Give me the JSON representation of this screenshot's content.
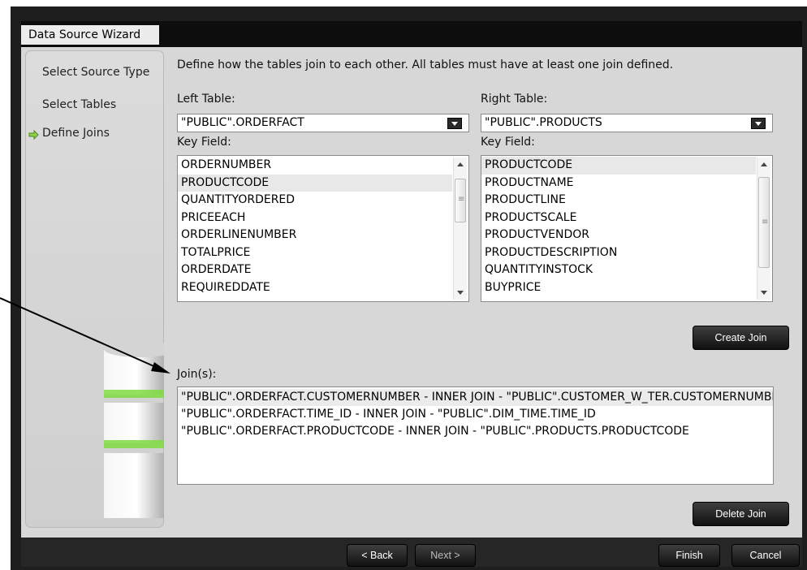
{
  "window": {
    "title": "Data Source Wizard"
  },
  "nav": {
    "items": [
      {
        "label": "Select Source Type"
      },
      {
        "label": "Select Tables"
      },
      {
        "label": "Define Joins"
      }
    ]
  },
  "description": "Define how the tables join to each other. All tables must have at least one join defined.",
  "left": {
    "table_label": "Left Table:",
    "table_value": "\"PUBLIC\".ORDERFACT",
    "key_label": "Key Field:",
    "fields": [
      "ORDERNUMBER",
      "PRODUCTCODE",
      "QUANTITYORDERED",
      "PRICEEACH",
      "ORDERLINENUMBER",
      "TOTALPRICE",
      "ORDERDATE",
      "REQUIREDDATE"
    ],
    "selected_field": "PRODUCTCODE"
  },
  "right": {
    "table_label": "Right Table:",
    "table_value": "\"PUBLIC\".PRODUCTS",
    "key_label": "Key Field:",
    "fields": [
      "PRODUCTCODE",
      "PRODUCTNAME",
      "PRODUCTLINE",
      "PRODUCTSCALE",
      "PRODUCTVENDOR",
      "PRODUCTDESCRIPTION",
      "QUANTITYINSTOCK",
      "BUYPRICE"
    ],
    "selected_field": "PRODUCTCODE"
  },
  "buttons": {
    "create_join": "Create Join",
    "delete_join": "Delete Join",
    "back": "< Back",
    "next": "Next >",
    "finish": "Finish",
    "cancel": "Cancel"
  },
  "joins": {
    "label": "Join(s):",
    "items": [
      "\"PUBLIC\".ORDERFACT.CUSTOMERNUMBER - INNER JOIN - \"PUBLIC\".CUSTOMER_W_TER.CUSTOMERNUMBER",
      "\"PUBLIC\".ORDERFACT.TIME_ID - INNER JOIN - \"PUBLIC\".DIM_TIME.TIME_ID",
      "\"PUBLIC\".ORDERFACT.PRODUCTCODE - INNER JOIN - \"PUBLIC\".PRODUCTS.PRODUCTCODE"
    ]
  },
  "colors": {
    "active_arrow": "#7cc63a",
    "glow": "#8ee04a",
    "button_dark": "#1a1a1a"
  }
}
